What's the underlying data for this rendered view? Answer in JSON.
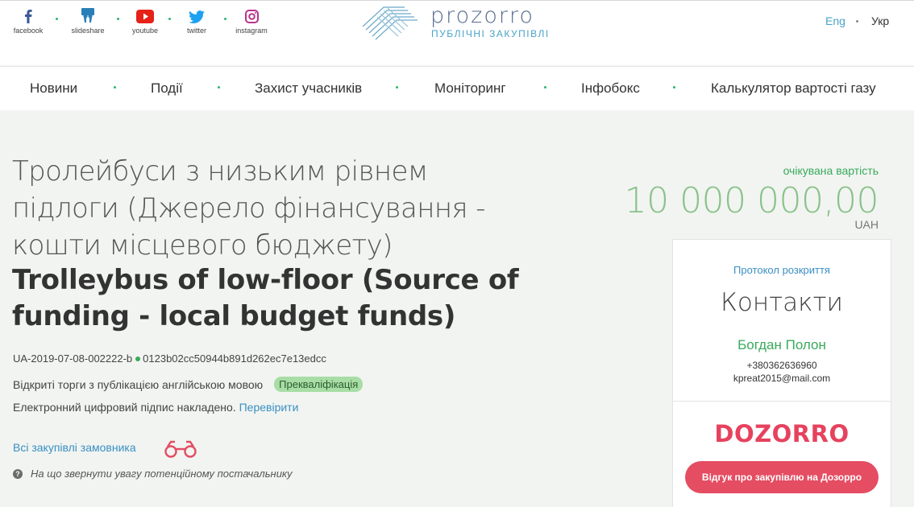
{
  "social": [
    {
      "label": "facebook",
      "icon": "facebook-icon"
    },
    {
      "label": "slideshare",
      "icon": "slideshare-icon"
    },
    {
      "label": "youtube",
      "icon": "youtube-icon"
    },
    {
      "label": "twitter",
      "icon": "twitter-icon"
    },
    {
      "label": "instagram",
      "icon": "instagram-icon"
    }
  ],
  "logo": {
    "name": "prozorro",
    "subtitle": "ПУБЛІЧНІ ЗАКУПІВЛІ"
  },
  "lang": {
    "en": "Eng",
    "uk": "Укр"
  },
  "nav": [
    "Новини",
    "Події",
    "Захист учасників",
    "Моніторинг",
    "Інфобокс",
    "Калькулятор вартості газу"
  ],
  "tender": {
    "title_ua": "Тролейбуси з низьким рівнем підлоги (Джерело фінансування - кошти місцевого бюджету)",
    "title_en": "Trolleybus of low-floor (Source of funding - local budget funds)",
    "id": "UA-2019-07-08-002222-b",
    "hash": "0123b02cc50944b891d262ec7e13edcc",
    "procedure": "Відкриті торги з публікацією англійською мовою",
    "status_badge": "Прекваліфікація",
    "signature_text": "Електронний цифровий підпис накладено.",
    "signature_link": "Перевірити",
    "all_purchases": "Всі закупівлі замовника",
    "hint": "На що звернути увагу потенційному постачальнику"
  },
  "value": {
    "label": "очікувана вартість",
    "amount": "10 000 000,00",
    "currency": "UAH"
  },
  "contact_card": {
    "protocol_link": "Протокол розкриття",
    "title": "Контакти",
    "person": "Богдан Полон",
    "phone": "+380362636960",
    "email": "kpreat2015@mail.com",
    "dozorro_logo": "DOZORRO",
    "dozorro_button": "Відгук про закупівлю на Дозорро"
  },
  "colors": {
    "accent_green": "#3aaa5c",
    "link_blue": "#3a8fc4",
    "dozorro_red": "#e44d62"
  }
}
